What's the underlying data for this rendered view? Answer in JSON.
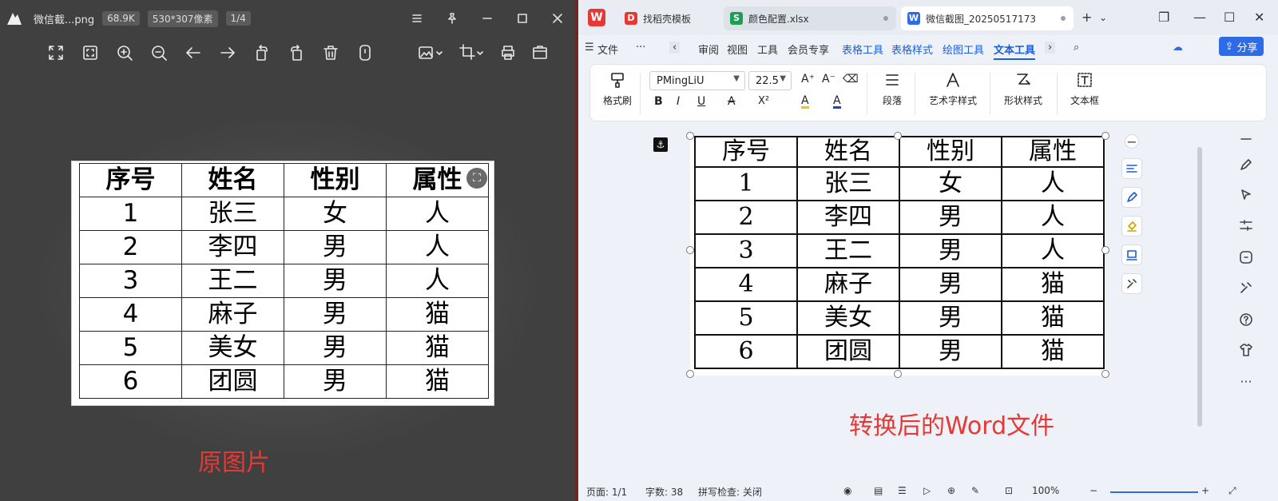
{
  "viewer": {
    "filename": "微信截...png",
    "filesize": "68.9K",
    "dimensions": "530*307像素",
    "page_index": "1/4",
    "caption": "原图片",
    "expand_icon": "⛶"
  },
  "source_table": {
    "headers": [
      "序号",
      "姓名",
      "性别",
      "属性"
    ],
    "rows": [
      [
        "1",
        "张三",
        "女",
        "人"
      ],
      [
        "2",
        "李四",
        "男",
        "人"
      ],
      [
        "3",
        "王二",
        "男",
        "人"
      ],
      [
        "4",
        "麻子",
        "男",
        "猫"
      ],
      [
        "5",
        "美女",
        "男",
        "猫"
      ],
      [
        "6",
        "团圆",
        "男",
        "猫"
      ]
    ]
  },
  "wps": {
    "tabs": [
      {
        "label": "找稻壳模板",
        "icon": "D"
      },
      {
        "label": "颜色配置.xlsx",
        "icon": "S"
      },
      {
        "label": "微信截图_20250517173",
        "icon": "W"
      }
    ],
    "menu": {
      "file": "文件",
      "more": "···",
      "items": [
        "审阅",
        "视图",
        "工具",
        "会员专享"
      ],
      "context": [
        "表格工具",
        "表格样式",
        "绘图工具"
      ],
      "active": "文本工具",
      "share": "分享"
    },
    "ribbon": {
      "format_painter": "格式刷",
      "font_name": "PMingLiU",
      "font_size": "22.5",
      "paragraph": "段落",
      "art_text": "艺术字样式",
      "shape_style": "形状样式",
      "text_box": "文本框",
      "bold": "B",
      "italic": "I",
      "underline": "U",
      "strike": "A",
      "superscript": "X²",
      "highlight": "A",
      "font_color": "A"
    },
    "caption": "转换后的Word文件",
    "status": {
      "page": "页面: 1/1",
      "words": "字数: 38",
      "spell": "拼写检查: 关闭",
      "zoom": "100%"
    }
  },
  "colors": {
    "caption_red": "#e53935",
    "wps_blue": "#2e6be6",
    "wps_red": "#e53935"
  }
}
